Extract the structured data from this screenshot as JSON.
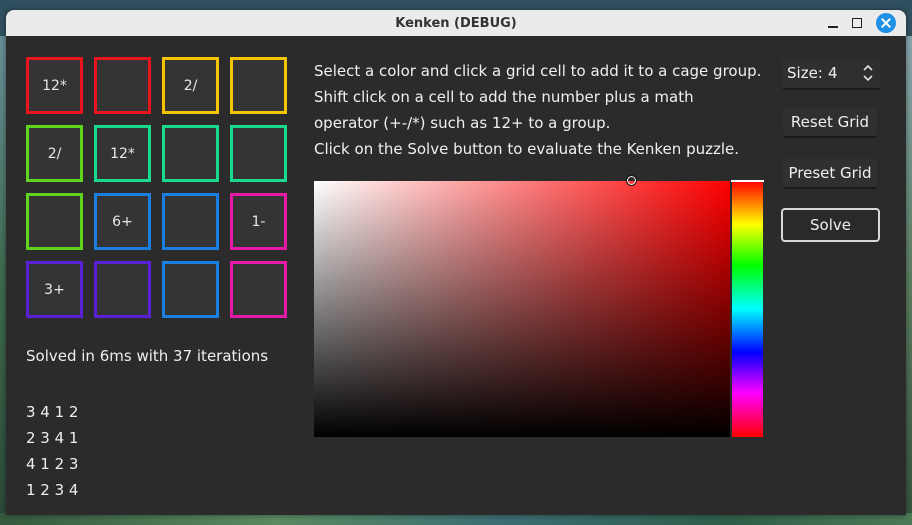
{
  "window": {
    "title": "Kenken (DEBUG)"
  },
  "grid": {
    "cells": [
      {
        "label": "12*",
        "color": "#e8141e"
      },
      {
        "label": "",
        "color": "#e8141e"
      },
      {
        "label": "2/",
        "color": "#f5c400"
      },
      {
        "label": "",
        "color": "#f5c400"
      },
      {
        "label": "2/",
        "color": "#5ed41e"
      },
      {
        "label": "12*",
        "color": "#19d98e"
      },
      {
        "label": "",
        "color": "#19d98e"
      },
      {
        "label": "",
        "color": "#19d98e"
      },
      {
        "label": "",
        "color": "#5ed41e"
      },
      {
        "label": "6+",
        "color": "#1a7fe0"
      },
      {
        "label": "",
        "color": "#1a7fe0"
      },
      {
        "label": "1-",
        "color": "#e61aa8"
      },
      {
        "label": "3+",
        "color": "#5a20d6"
      },
      {
        "label": "",
        "color": "#5a20d6"
      },
      {
        "label": "",
        "color": "#1a7fe0"
      },
      {
        "label": "",
        "color": "#e61aa8"
      }
    ]
  },
  "status": "Solved in 6ms with 37 iterations",
  "solution_rows": [
    "3 4 1 2",
    "2 3 4 1",
    "4 1 2 3",
    "1 2 3 4"
  ],
  "instructions": [
    "Select a color and click a grid cell to add it to a cage group.",
    "Shift click on a cell to add the number plus a math",
    "operator (+-/*) such as 12+ to a group.",
    "Click on the Solve button to evaluate the Kenken puzzle."
  ],
  "size": {
    "label": "Size:",
    "value": "4"
  },
  "buttons": {
    "reset": "Reset Grid",
    "preset": "Preset Grid",
    "solve": "Solve"
  },
  "picker": {
    "selected_hue": "#ff0000"
  }
}
